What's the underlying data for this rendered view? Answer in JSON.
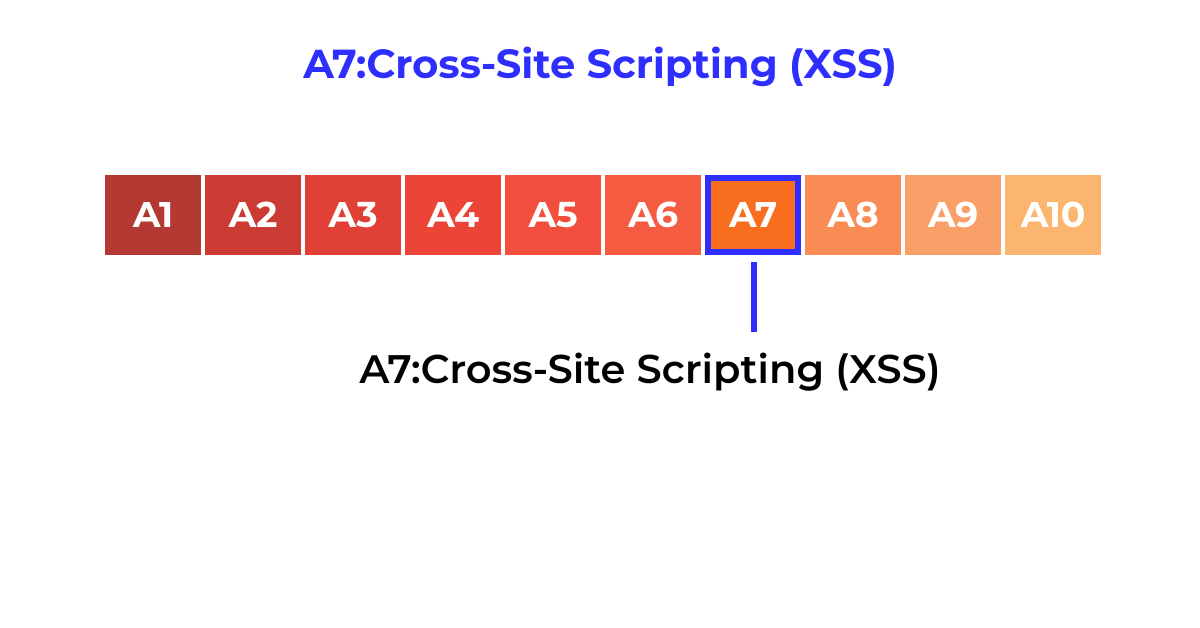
{
  "title": "A7:Cross-Site Scripting (XSS)",
  "annotation": "A7:Cross-Site Scripting (XSS)",
  "chart_data": {
    "type": "bar",
    "title": "A7:Cross-Site Scripting (XSS)",
    "categories": [
      "A1",
      "A2",
      "A3",
      "A4",
      "A5",
      "A6",
      "A7",
      "A8",
      "A9",
      "A10"
    ],
    "colors": [
      "#B33932",
      "#CC3B33",
      "#E04036",
      "#EC4538",
      "#F24E3D",
      "#F55B41",
      "#F96E1E",
      "#F98C55",
      "#F9A068",
      "#FCB56E"
    ],
    "highlighted_index": 6,
    "highlight_color": "#2E2EFF",
    "annotation": "A7:Cross-Site Scripting (XSS)"
  }
}
